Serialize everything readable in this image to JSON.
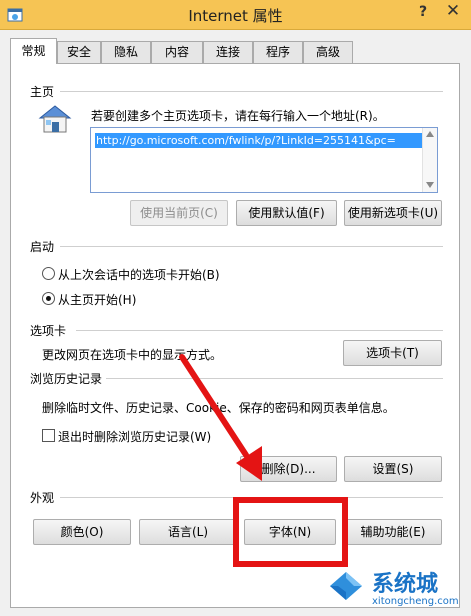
{
  "window": {
    "title": "Internet 属性",
    "help": "?",
    "close": "✕"
  },
  "tabs": [
    {
      "label": "常规",
      "active": true
    },
    {
      "label": "安全"
    },
    {
      "label": "隐私"
    },
    {
      "label": "内容"
    },
    {
      "label": "连接"
    },
    {
      "label": "程序"
    },
    {
      "label": "高级"
    }
  ],
  "home": {
    "group_title": "主页",
    "instruction": "若要创建多个主页选项卡，请在每行输入一个地址(R)。",
    "url": "http://go.microsoft.com/fwlink/p/?LinkId=255141&pc=",
    "use_current": "使用当前页(C)",
    "use_default": "使用默认值(F)",
    "use_new_tab": "使用新选项卡(U)"
  },
  "startup": {
    "group_title": "启动",
    "option_last_session": "从上次会话中的选项卡开始(B)",
    "option_home": "从主页开始(H)",
    "selected": "option_home"
  },
  "tabs_group": {
    "group_title": "选项卡",
    "description": "更改网页在选项卡中的显示方式。",
    "button": "选项卡(T)"
  },
  "history": {
    "group_title": "浏览历史记录",
    "description": "删除临时文件、历史记录、Cookie、保存的密码和网页表单信息。",
    "checkbox_label": "退出时删除浏览历史记录(W)",
    "checked": false,
    "delete_button": "删除(D)...",
    "settings_button": "设置(S)"
  },
  "appearance": {
    "group_title": "外观",
    "colors": "颜色(O)",
    "languages": "语言(L)",
    "fonts": "字体(N)",
    "accessibility": "辅助功能(E)"
  },
  "annotation": {
    "arrow_color": "#e41414",
    "highlight_color": "#e41414"
  },
  "watermark": {
    "name": "系统城",
    "url": "xitongcheng.com",
    "color": "#1a73c6"
  }
}
